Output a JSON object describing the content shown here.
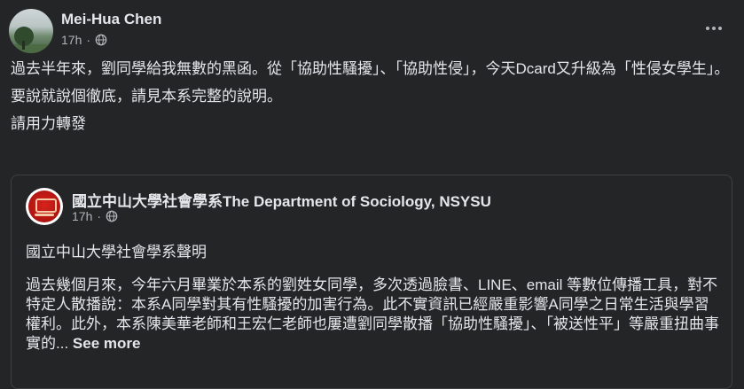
{
  "post": {
    "author": "Mei-Hua Chen",
    "time": "17h",
    "privacy_icon": "globe-icon",
    "paragraphs": [
      "過去半年來，劉同學給我無數的黑函。從「協助性騷擾」、「協助性侵」，今天Dcard又升級為「性侵女學生」。",
      "要說就說個徹底，請見本系完整的說明。",
      "請用力轉發"
    ],
    "more_icon": "more-options-icon"
  },
  "shared": {
    "page_name": "國立中山大學社會學系The Department of Sociology, NSYSU",
    "time": "17h",
    "title_line": "國立中山大學社會學系聲明",
    "body": "過去幾個月來，今年六月畢業於本系的劉姓女同學，多次透過臉書、LINE、email 等數位傳播工具，對不特定人散播說：本系A同學對其有性騷擾的加害行為。此不實資訊已經嚴重影響A同學之日常生活與學習權利。此外，本系陳美華老師和王宏仁老師也屢遭劉同學散播「協助性騷擾」、「被送性平」等嚴重扭曲事實的...",
    "see_more": "See more"
  },
  "colors": {
    "background": "#242526",
    "primary_text": "#e4e6eb",
    "secondary_text": "#b0b3b8",
    "border": "#3e4042"
  }
}
